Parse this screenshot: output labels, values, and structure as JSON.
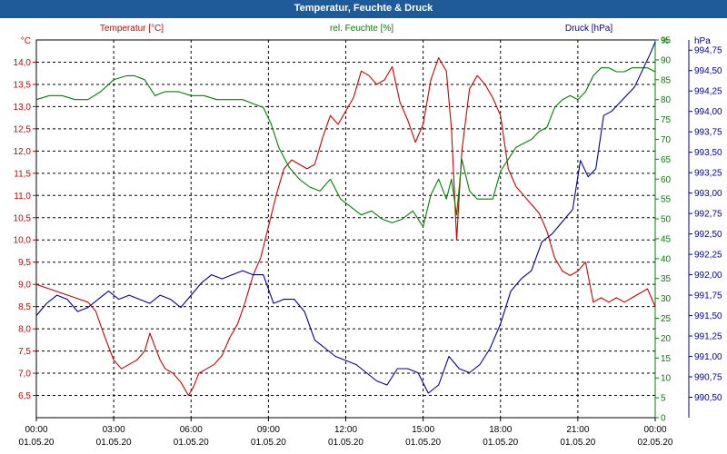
{
  "title": "Temperatur, Feuchte & Druck",
  "chart_data": {
    "type": "line",
    "x_ticks": [
      {
        "time": "00:00",
        "date": "01.05.20"
      },
      {
        "time": "03:00",
        "date": "01.05.20"
      },
      {
        "time": "06:00",
        "date": "01.05.20"
      },
      {
        "time": "09:00",
        "date": "01.05.20"
      },
      {
        "time": "12:00",
        "date": "01.05.20"
      },
      {
        "time": "15:00",
        "date": "01.05.20"
      },
      {
        "time": "18:00",
        "date": "01.05.20"
      },
      {
        "time": "21:00",
        "date": "01.05.20"
      },
      {
        "time": "00:00",
        "date": "02.05.20"
      }
    ],
    "x_range": [
      0,
      24
    ],
    "axes": {
      "temp": {
        "label": "Temperatur [°C]",
        "unit": "°C",
        "color": "#cc0000",
        "range": [
          6.0,
          14.5
        ],
        "ticks": [
          "6,5",
          "7,0",
          "7,5",
          "8,0",
          "8,5",
          "9,0",
          "9,5",
          "10,0",
          "10,5",
          "11,0",
          "11,5",
          "12,0",
          "12,5",
          "13,0",
          "13,5",
          "14,0"
        ]
      },
      "hum": {
        "label": "rel. Feuchte [%]",
        "unit": "%",
        "color": "#008000",
        "range": [
          0,
          95
        ],
        "ticks": [
          "0",
          "5",
          "10",
          "15",
          "20",
          "25",
          "30",
          "35",
          "40",
          "45",
          "50",
          "55",
          "60",
          "65",
          "70",
          "75",
          "80",
          "85",
          "90",
          "95"
        ]
      },
      "press": {
        "label": "Druck [hPa]",
        "unit": "hPa",
        "color": "#000099",
        "range": [
          990.25,
          994.875
        ],
        "ticks": [
          "990,50",
          "990,75",
          "991,00",
          "991,25",
          "991,50",
          "991,75",
          "992,00",
          "992,25",
          "992,50",
          "992,75",
          "993,00",
          "993,25",
          "993,50",
          "993,75",
          "994,00",
          "994,25",
          "994,50",
          "994,75"
        ]
      }
    },
    "grid": true,
    "series": [
      {
        "name": "Temperatur [°C]",
        "axis": "temp",
        "color": "#cc0000",
        "x": [
          0,
          0.5,
          1,
          1.5,
          2,
          2.3,
          2.6,
          3,
          3.3,
          3.6,
          3.9,
          4.2,
          4.4,
          4.6,
          4.8,
          5,
          5.3,
          5.6,
          5.9,
          6.1,
          6.3,
          6.6,
          6.9,
          7.2,
          7.5,
          7.8,
          8.1,
          8.4,
          8.7,
          9,
          9.3,
          9.6,
          9.9,
          10.2,
          10.5,
          10.8,
          11.1,
          11.4,
          11.7,
          12,
          12.3,
          12.6,
          12.9,
          13.2,
          13.5,
          13.8,
          14.1,
          14.4,
          14.7,
          15,
          15.3,
          15.6,
          15.9,
          16.1,
          16.3,
          16.5,
          16.8,
          17.1,
          17.4,
          17.7,
          18,
          18.3,
          18.6,
          18.9,
          19.2,
          19.5,
          19.8,
          20.1,
          20.4,
          20.7,
          21,
          21.3,
          21.6,
          21.9,
          22.2,
          22.5,
          22.8,
          23.1,
          23.4,
          23.7,
          24
        ],
        "y": [
          9.0,
          8.9,
          8.8,
          8.7,
          8.6,
          8.4,
          7.9,
          7.3,
          7.1,
          7.2,
          7.3,
          7.5,
          7.9,
          7.6,
          7.3,
          7.1,
          7.0,
          6.8,
          6.5,
          6.7,
          7.0,
          7.1,
          7.2,
          7.4,
          7.8,
          8.1,
          8.6,
          9.2,
          9.6,
          10.3,
          11.0,
          11.6,
          11.8,
          11.7,
          11.6,
          11.7,
          12.3,
          12.8,
          12.6,
          12.9,
          13.2,
          13.8,
          13.7,
          13.5,
          13.6,
          13.9,
          13.1,
          12.7,
          12.2,
          12.6,
          13.6,
          14.1,
          13.8,
          12.5,
          10.0,
          12.0,
          13.4,
          13.7,
          13.5,
          13.2,
          12.8,
          11.6,
          11.2,
          11.0,
          10.8,
          10.6,
          10.2,
          9.6,
          9.3,
          9.2,
          9.3,
          9.5,
          8.6,
          8.7,
          8.6,
          8.7,
          8.6,
          8.7,
          8.8,
          8.9,
          8.5
        ]
      },
      {
        "name": "rel. Feuchte [%]",
        "axis": "hum",
        "color": "#008000",
        "x": [
          0,
          0.5,
          1,
          1.5,
          2,
          2.5,
          3,
          3.5,
          3.8,
          4.2,
          4.6,
          5,
          5.5,
          6,
          6.5,
          7,
          7.5,
          8,
          8.4,
          8.8,
          9.1,
          9.4,
          9.8,
          10.2,
          10.6,
          11,
          11.4,
          11.8,
          12.2,
          12.6,
          13,
          13.4,
          13.8,
          14.2,
          14.6,
          15,
          15.3,
          15.6,
          15.9,
          16.1,
          16.3,
          16.5,
          16.8,
          17.1,
          17.4,
          17.7,
          18,
          18.3,
          18.6,
          18.9,
          19.2,
          19.5,
          19.8,
          20.1,
          20.4,
          20.7,
          21,
          21.3,
          21.6,
          21.9,
          22.2,
          22.5,
          22.8,
          23.1,
          23.4,
          23.7,
          24
        ],
        "y": [
          80,
          81,
          81,
          80,
          80,
          82,
          85,
          86,
          86,
          85,
          81,
          82,
          82,
          81,
          81,
          80,
          80,
          80,
          79,
          78,
          74,
          68,
          63,
          60,
          58,
          57,
          60,
          55,
          53,
          51,
          52,
          50,
          49,
          50,
          52,
          48,
          56,
          60,
          55,
          60,
          51,
          65,
          57,
          55,
          55,
          55,
          62,
          65,
          68,
          69,
          70,
          72,
          73,
          78,
          80,
          81,
          80,
          82,
          86,
          88,
          88,
          87,
          87,
          88,
          88,
          88,
          87
        ]
      },
      {
        "name": "Druck [hPa]",
        "axis": "press",
        "color": "#000099",
        "x": [
          0,
          0.4,
          0.8,
          1.2,
          1.6,
          2,
          2.4,
          2.8,
          3.2,
          3.6,
          4,
          4.4,
          4.8,
          5.2,
          5.6,
          6,
          6.4,
          6.8,
          7.2,
          7.6,
          8,
          8.4,
          8.8,
          9.2,
          9.6,
          10,
          10.4,
          10.8,
          11.2,
          11.6,
          12,
          12.4,
          12.8,
          13.2,
          13.6,
          14,
          14.4,
          14.8,
          15.2,
          15.6,
          16,
          16.4,
          16.8,
          17.2,
          17.6,
          18,
          18.4,
          18.8,
          19.2,
          19.6,
          20,
          20.4,
          20.8,
          21.1,
          21.4,
          21.7,
          22,
          22.3,
          22.6,
          22.9,
          23.2,
          23.5,
          23.8,
          24
        ],
        "y": [
          991.5,
          991.65,
          991.75,
          991.7,
          991.55,
          991.6,
          991.7,
          991.8,
          991.7,
          991.75,
          991.7,
          991.65,
          991.75,
          991.7,
          991.6,
          991.75,
          991.9,
          992.0,
          991.95,
          992.0,
          992.05,
          992.0,
          992.0,
          991.65,
          991.7,
          991.7,
          991.55,
          991.2,
          991.1,
          991.0,
          990.95,
          990.9,
          990.8,
          990.7,
          990.65,
          990.85,
          990.85,
          990.8,
          990.55,
          990.65,
          991.0,
          990.85,
          990.8,
          990.9,
          991.1,
          991.4,
          991.8,
          991.95,
          992.05,
          992.4,
          992.5,
          992.65,
          992.8,
          993.4,
          993.2,
          993.3,
          993.95,
          994.0,
          994.1,
          994.2,
          994.3,
          994.5,
          994.7,
          994.85
        ]
      }
    ]
  }
}
